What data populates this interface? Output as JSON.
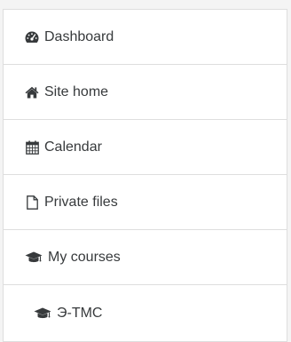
{
  "navigation": {
    "items": [
      {
        "label": "Dashboard",
        "icon": "dashboard-icon"
      },
      {
        "label": "Site home",
        "icon": "home-icon"
      },
      {
        "label": "Calendar",
        "icon": "calendar-icon"
      },
      {
        "label": "Private files",
        "icon": "file-icon"
      },
      {
        "label": "My courses",
        "icon": "graduation-cap-icon"
      },
      {
        "label": "Э-ТМС",
        "icon": "graduation-cap-icon"
      }
    ]
  },
  "colors": {
    "text": "#373a3c",
    "border": "#dedede",
    "background": "#f4f4f4",
    "panel": "#ffffff"
  }
}
